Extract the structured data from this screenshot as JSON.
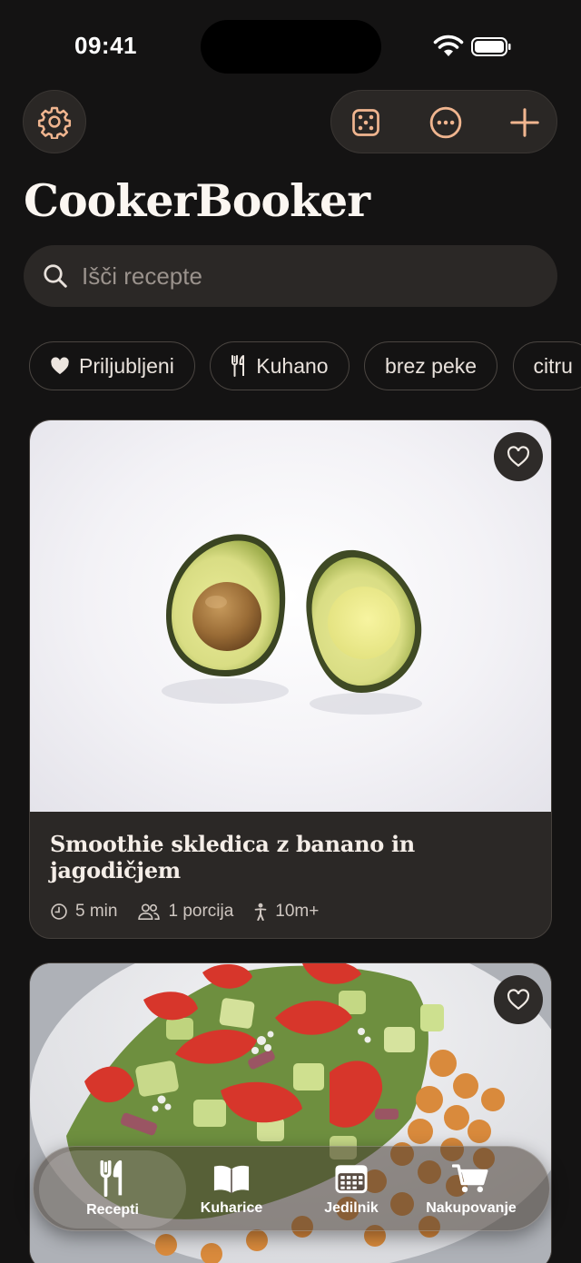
{
  "status_bar": {
    "time": "09:41"
  },
  "header": {
    "title": "CookerBooker"
  },
  "top_actions": {
    "settings": "gear-icon",
    "random": "dice-icon",
    "more": "ellipsis-circle-icon",
    "add": "plus-icon"
  },
  "search": {
    "placeholder": "Išči recepte",
    "value": ""
  },
  "filters": [
    {
      "label": "Priljubljeni",
      "icon": "heart-icon"
    },
    {
      "label": "Kuhano",
      "icon": "fork-knife-icon"
    },
    {
      "label": "brez peke",
      "icon": ""
    },
    {
      "label": "citru",
      "icon": ""
    }
  ],
  "recipes": [
    {
      "title": "Smoothie skledica z banano in jagodičjem",
      "time": "5 min",
      "servings": "1 porcija",
      "age": "10m+",
      "image": "avocado halves"
    },
    {
      "title": "",
      "image": "tomato cucumber salad with chickpeas"
    }
  ],
  "tabbar": {
    "tabs": [
      {
        "label": "Recepti",
        "icon": "fork-knife-icon",
        "active": true
      },
      {
        "label": "Kuharice",
        "icon": "book-icon",
        "active": false
      },
      {
        "label": "Jedilnik",
        "icon": "calendar-icon",
        "active": false
      },
      {
        "label": "Nakupovanje",
        "icon": "cart-icon",
        "active": false
      }
    ]
  },
  "colors": {
    "accent": "#f0b58f",
    "background": "#141313",
    "surface": "#2b2826"
  }
}
